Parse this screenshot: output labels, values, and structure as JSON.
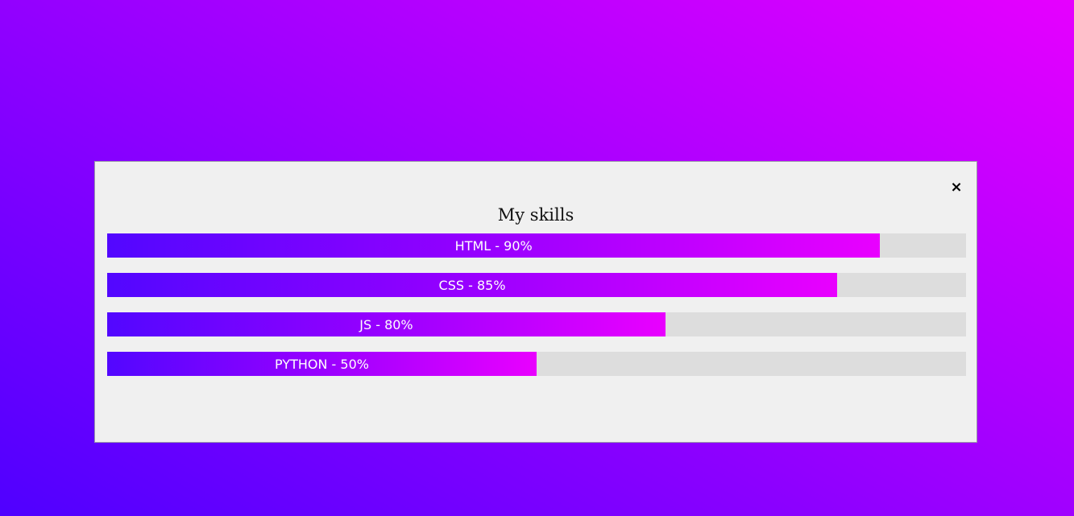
{
  "modal": {
    "close_label": "×",
    "title": "My skills"
  },
  "skills": [
    {
      "label": "HTML - 90%",
      "level_percent": 90
    },
    {
      "label": "CSS - 85%",
      "level_percent": 85
    },
    {
      "label": "JS - 80%",
      "level_percent": 65
    },
    {
      "label": "PYTHON - 50%",
      "level_percent": 50
    }
  ],
  "colors": {
    "bar_gradient_start": "#5207ff",
    "bar_gradient_end": "#e900ff",
    "track": "#dddddd",
    "modal_background": "#f0f0f0",
    "page_gradient_start": "#4f00ff",
    "page_gradient_end": "#e600ff"
  },
  "icons": {
    "close": "close-icon"
  }
}
